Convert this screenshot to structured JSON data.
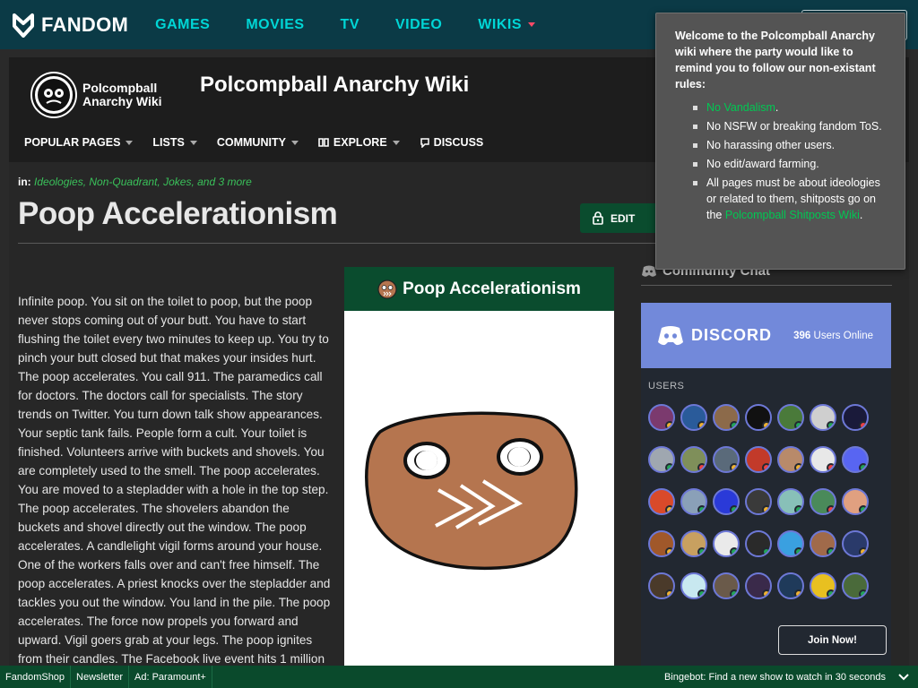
{
  "fandom_bar": {
    "logo_text": "FANDOM",
    "nav": [
      "GAMES",
      "MOVIES",
      "TV",
      "VIDEO",
      "WIKIS"
    ]
  },
  "wiki": {
    "logo_text": "Polcompball Anarchy Wiki",
    "title": "Polcompball Anarchy Wiki",
    "nav": [
      "POPULAR PAGES",
      "LISTS",
      "COMMUNITY",
      "EXPLORE",
      "DISCUSS"
    ]
  },
  "page": {
    "categories_prefix": "in:",
    "categories": "Ideologies, Non-Quadrant, Jokes, and 3 more",
    "title": "Poop Accelerationism",
    "edit_label": "EDIT",
    "body": "Infinite poop. You sit on the toilet to poop, but the poop never stops coming out of your butt. You have to start flushing the toilet every two minutes to keep up. You try to pinch your butt closed but that makes your insides hurt. The poop accelerates. You call 911. The paramedics call for doctors. The doctors call for specialists. The story trends on Twitter. You turn down talk show appearances. Your septic tank fails. People form a cult. Your toilet is finished. Volunteers arrive with buckets and shovels. You are completely used to the smell. The poop accelerates. You are moved to a stepladder with a hole in the top step. The poop accelerates. The shovelers abandon the buckets and shovel directly out the window. The poop accelerates. A candlelight vigil forms around your house. One of the workers falls over and can't free himself. The poop accelerates. A priest knocks over the stepladder and tackles you out the window. You land in the pile. The poop accelerates. The force now propels you forward and upward. Vigil goers grab at your legs. The poop ignites from their candles. The Facebook live event hits 1 million"
  },
  "infobox": {
    "title": "Poop Accelerationism"
  },
  "community_chat": {
    "title": "Community Chat",
    "discord_name": "DISCORD",
    "online_count": "396",
    "online_label": "Users Online",
    "users_label": "USERS",
    "join_label": "Join Now!",
    "status_colors": [
      "#f0b232",
      "#f0b232",
      "#23a55a",
      "#f0b232",
      "#23a55a",
      "#23a55a",
      "#ed4245",
      "#23a55a",
      "#ed4245",
      "#f0b232",
      "#ed4245",
      "#f0b232",
      "#ed4245",
      "#23a55a",
      "#f0b232",
      "#23a55a",
      "#23a55a",
      "#f0b232",
      "#23a55a",
      "#ed4245",
      "#23a55a",
      "#f0b232",
      "#23a55a",
      "#23a55a",
      "#23a55a",
      "#23a55a",
      "#23a55a",
      "#f0b232",
      "#f0b232",
      "#23a55a",
      "#23a55a",
      "#f0b232",
      "#f0b232",
      "#23a55a",
      "#23a55a"
    ],
    "avatar_colors": [
      "#7b3a6e",
      "#2a5b9a",
      "#8c6a4a",
      "#111111",
      "#4a7a3a",
      "#cfcfcf",
      "#1a1a3a",
      "#9fa7b0",
      "#7f8f5a",
      "#5a6a7a",
      "#c23a2a",
      "#b88a6a",
      "#e8e8e8",
      "#5865f2",
      "#d94a2a",
      "#8aa0b8",
      "#2a3ad8",
      "#3a3a3a",
      "#88c0b8",
      "#4a8a5a",
      "#e0a080",
      "#a0582a",
      "#c8a060",
      "#eaeaea",
      "#2a2a2a",
      "#3aa0e0",
      "#a06a4a",
      "#2a3a6a",
      "#4a3a2a",
      "#c8e8f0",
      "#6a5a4a",
      "#3a2a4a",
      "#1f3a5a",
      "#e8c020",
      "#4a6a3a"
    ]
  },
  "popup": {
    "intro": "Welcome to the Polcompball Anarchy wiki where the party would like to remind you to follow our non-existant rules:",
    "rule1": "No Vandalism",
    "rule2": "No NSFW or breaking fandom ToS.",
    "rule3": "No harassing other users.",
    "rule4": "No edit/award farming.",
    "rule5_pre": "All pages must be about ideologies or related to them, shitposts go on the ",
    "rule5_link": "Polcompball Shitposts Wiki",
    "period": "."
  },
  "bottom_bar": {
    "items": [
      "FandomShop",
      "Newsletter",
      "Ad: Paramount+"
    ],
    "bingebot": "Bingebot: Find a new show to watch in 30 seconds"
  },
  "colors": {
    "fandom_bar": "#0b3a46",
    "link_cyan": "#00d6d6",
    "accent_green": "#0a4c2e",
    "discord": "#7289da"
  }
}
